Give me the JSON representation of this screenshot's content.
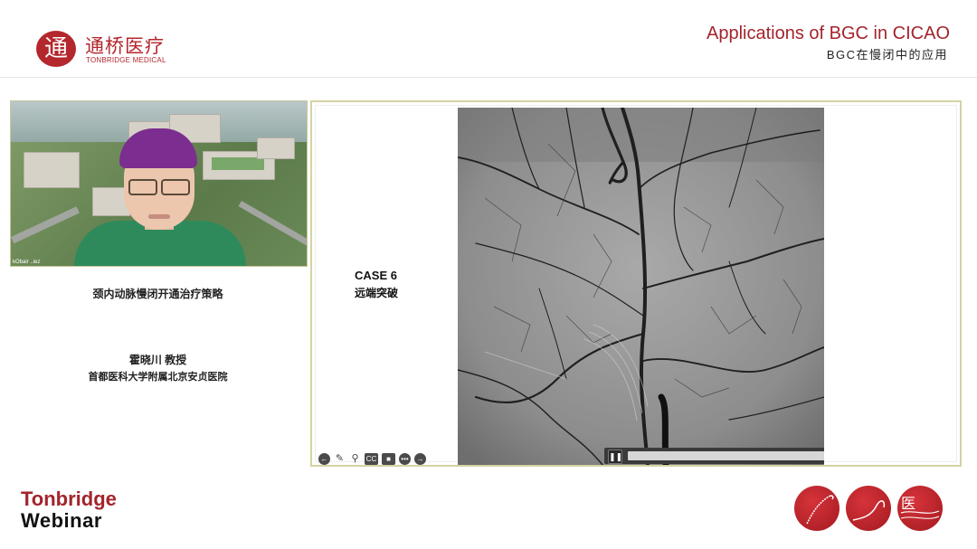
{
  "brand": {
    "logo_glyph": "通",
    "name_cn": "通桥医疗",
    "name_en": "TONBRIDGE MEDICAL",
    "color": "#b3272d"
  },
  "header": {
    "title_en": "Applications of BGC in CICAO",
    "title_cn": "BGC在慢闭中的应用"
  },
  "speaker_panel": {
    "video_tag": "kObair ..iez",
    "talk_title": "颈内动脉慢闭开通治疗策略",
    "speaker_name": "霍晓川 教授",
    "institution": "首都医科大学附属北京安贞医院"
  },
  "slide": {
    "case_title": "CASE 6",
    "case_subtitle": "远端突破",
    "player": {
      "pause_icon": "pause-icon",
      "pause_glyph": "❚❚",
      "volume_glyph": "◂",
      "progress": 0.0
    },
    "toolbar": [
      {
        "name": "back-arrow-icon",
        "glyph": "←"
      },
      {
        "name": "pen-icon",
        "glyph": "✎"
      },
      {
        "name": "zoom-icon",
        "glyph": "⚲"
      },
      {
        "name": "cc-icon",
        "glyph": "CC"
      },
      {
        "name": "camera-icon",
        "glyph": "■"
      },
      {
        "name": "more-icon",
        "glyph": "•••"
      },
      {
        "name": "forward-arrow-icon",
        "glyph": "→"
      }
    ]
  },
  "footer": {
    "webinar_line1": "Tonbridge",
    "webinar_line2": "Webinar",
    "badge_glyph": "医"
  },
  "colors": {
    "accent_red": "#a3242c",
    "frame_border": "#d4d3a3"
  }
}
